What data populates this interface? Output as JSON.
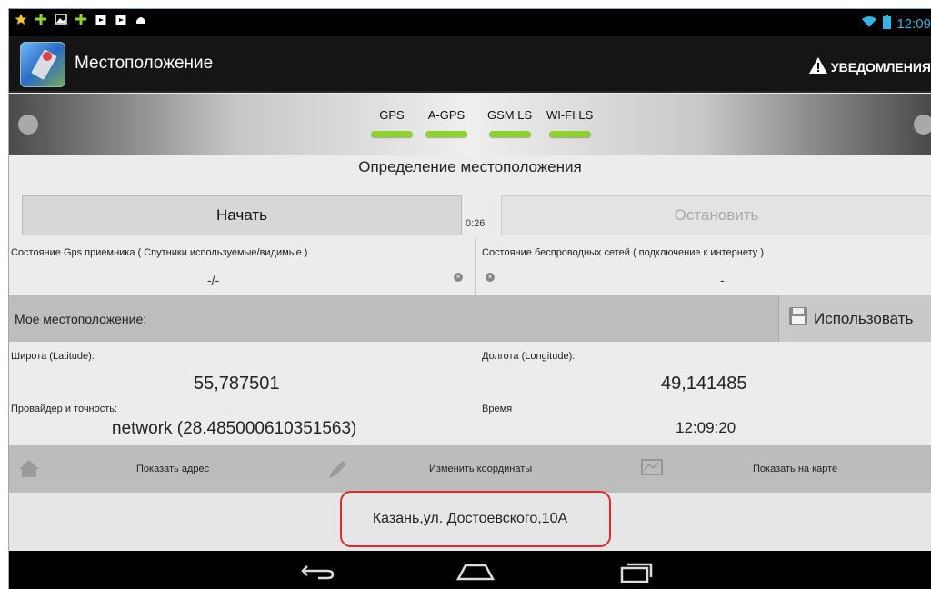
{
  "status_bar": {
    "time": "12:09"
  },
  "action_bar": {
    "title": "Местоположение",
    "notifications_label": "УВЕДОМЛЕНИЯ"
  },
  "tabs": [
    {
      "label": "GPS",
      "indicator_color": "#8fd22b"
    },
    {
      "label": "A-GPS",
      "indicator_color": "#8fd22b"
    },
    {
      "label": "GSM LS",
      "indicator_color": "#8fd22b"
    },
    {
      "label": "WI-FI LS",
      "indicator_color": "#8fd22b"
    }
  ],
  "location": {
    "section_title": "Определение местоположения",
    "start_label": "Начать",
    "stop_label": "Остановить",
    "timer": "0:26",
    "gps_status_label": "Состояние Gps приемника ( Спутники используемые/видимые )",
    "gps_status_value": "-/-",
    "network_status_label": "Состояние беспроводных сетей ( подключение к интернету )",
    "network_status_value": "-"
  },
  "my_position": {
    "label": "Мое местоположение:",
    "use_label": "Использовать",
    "latitude_label": "Широта (Latitude):",
    "latitude_value": "55,787501",
    "longitude_label": "Долгота (Longitude):",
    "longitude_value": "49,141485",
    "provider_label": "Провайдер и точность:",
    "provider_value": "network (28.485000610351563)",
    "time_label": "Время",
    "time_value": "12:09:20"
  },
  "toolbar": {
    "show_address": "Показать адрес",
    "edit_coords": "Изменить координаты",
    "show_map": "Показать на карте"
  },
  "address": {
    "text": "Казань,ул. Достоевского,10А"
  },
  "colors": {
    "highlight_frame": "#e02a2a",
    "accent": "#33b5e5"
  }
}
